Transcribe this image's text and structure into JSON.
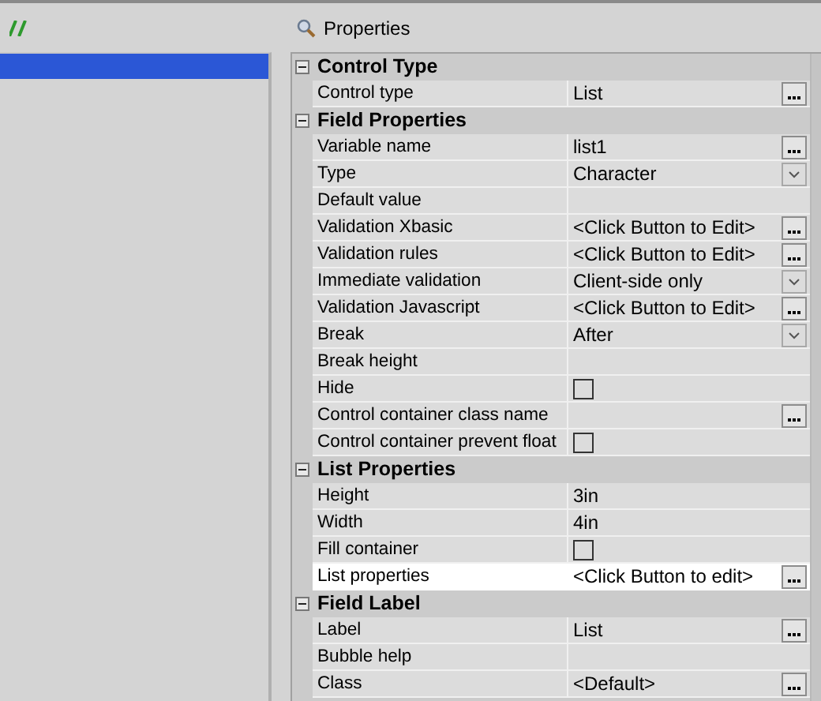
{
  "left_pane": {
    "items": [
      {
        "selected": true
      }
    ]
  },
  "properties": {
    "title": "Properties",
    "sections": [
      {
        "title": "Control Type",
        "expanded": true,
        "rows": [
          {
            "name": "Control type",
            "value": "List",
            "kind": "button",
            "selected": false
          }
        ]
      },
      {
        "title": "Field Properties",
        "expanded": true,
        "rows": [
          {
            "name": "Variable name",
            "value": "list1",
            "kind": "button",
            "selected": false
          },
          {
            "name": "Type",
            "value": "Character",
            "kind": "dropdown",
            "selected": false
          },
          {
            "name": "Default value",
            "kind": "text",
            "selected": false
          },
          {
            "name": "Validation Xbasic",
            "value": "<Click Button to Edit>",
            "kind": "button",
            "selected": false
          },
          {
            "name": "Validation rules",
            "value": "<Click Button to Edit>",
            "kind": "button",
            "selected": false
          },
          {
            "name": "Immediate validation",
            "value": "Client-side only",
            "kind": "dropdown",
            "selected": false
          },
          {
            "name": "Validation Javascript",
            "value": "<Click Button to Edit>",
            "kind": "button",
            "selected": false
          },
          {
            "name": "Break",
            "value": "After",
            "kind": "dropdown",
            "selected": false
          },
          {
            "name": "Break height",
            "kind": "text",
            "selected": false
          },
          {
            "name": "Hide",
            "kind": "checkbox",
            "checked": false,
            "selected": false
          },
          {
            "name": "Control container class name",
            "kind": "button",
            "selected": false
          },
          {
            "name": "Control container prevent float",
            "kind": "checkbox",
            "checked": false,
            "selected": false
          }
        ]
      },
      {
        "title": "List Properties",
        "expanded": true,
        "rows": [
          {
            "name": "Height",
            "value": "3in",
            "kind": "text",
            "selected": false
          },
          {
            "name": "Width",
            "value": "4in",
            "kind": "text",
            "selected": false
          },
          {
            "name": "Fill container",
            "kind": "checkbox",
            "checked": false,
            "selected": false
          },
          {
            "name": "List properties",
            "value": "<Click Button to edit>",
            "kind": "button",
            "selected": true
          }
        ]
      },
      {
        "title": "Field Label",
        "expanded": true,
        "rows": [
          {
            "name": "Label",
            "value": "List",
            "kind": "button",
            "selected": false
          },
          {
            "name": "Bubble help",
            "kind": "text",
            "selected": false
          },
          {
            "name": "Class",
            "value": "<Default>",
            "kind": "button",
            "selected": false
          }
        ]
      }
    ]
  }
}
